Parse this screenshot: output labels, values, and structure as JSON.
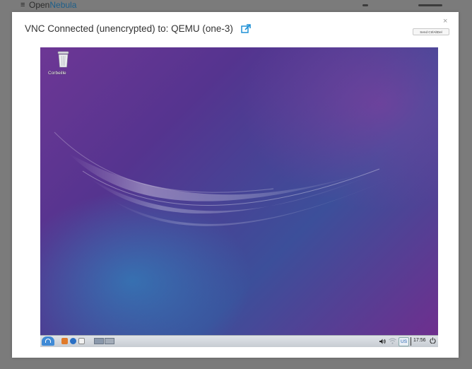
{
  "background_app": {
    "brand_prefix": "Open",
    "brand_suffix": "Nebula",
    "menu_icon": "hamburger-icon"
  },
  "modal": {
    "title": "VNC Connected (unencrypted) to: QEMU (one-3)",
    "external_link_icon": "external-link-icon",
    "close_label": "×",
    "send_ctrl_alt_del_label": "Send CtrlAltDel"
  },
  "desktop": {
    "trash_label": "Corbeille",
    "trash_icon": "trash-icon",
    "taskbar": {
      "start_icon": "start-menu-icon",
      "keyboard_layout": "US",
      "clock": "17:56",
      "volume_icon": "volume-icon",
      "network_icon": "wifi-icon",
      "power_icon": "power-icon"
    }
  },
  "colors": {
    "accent": "#1e90d6",
    "desktop_purple": "#5b2f8f",
    "desktop_blue": "#3c5aa0"
  }
}
